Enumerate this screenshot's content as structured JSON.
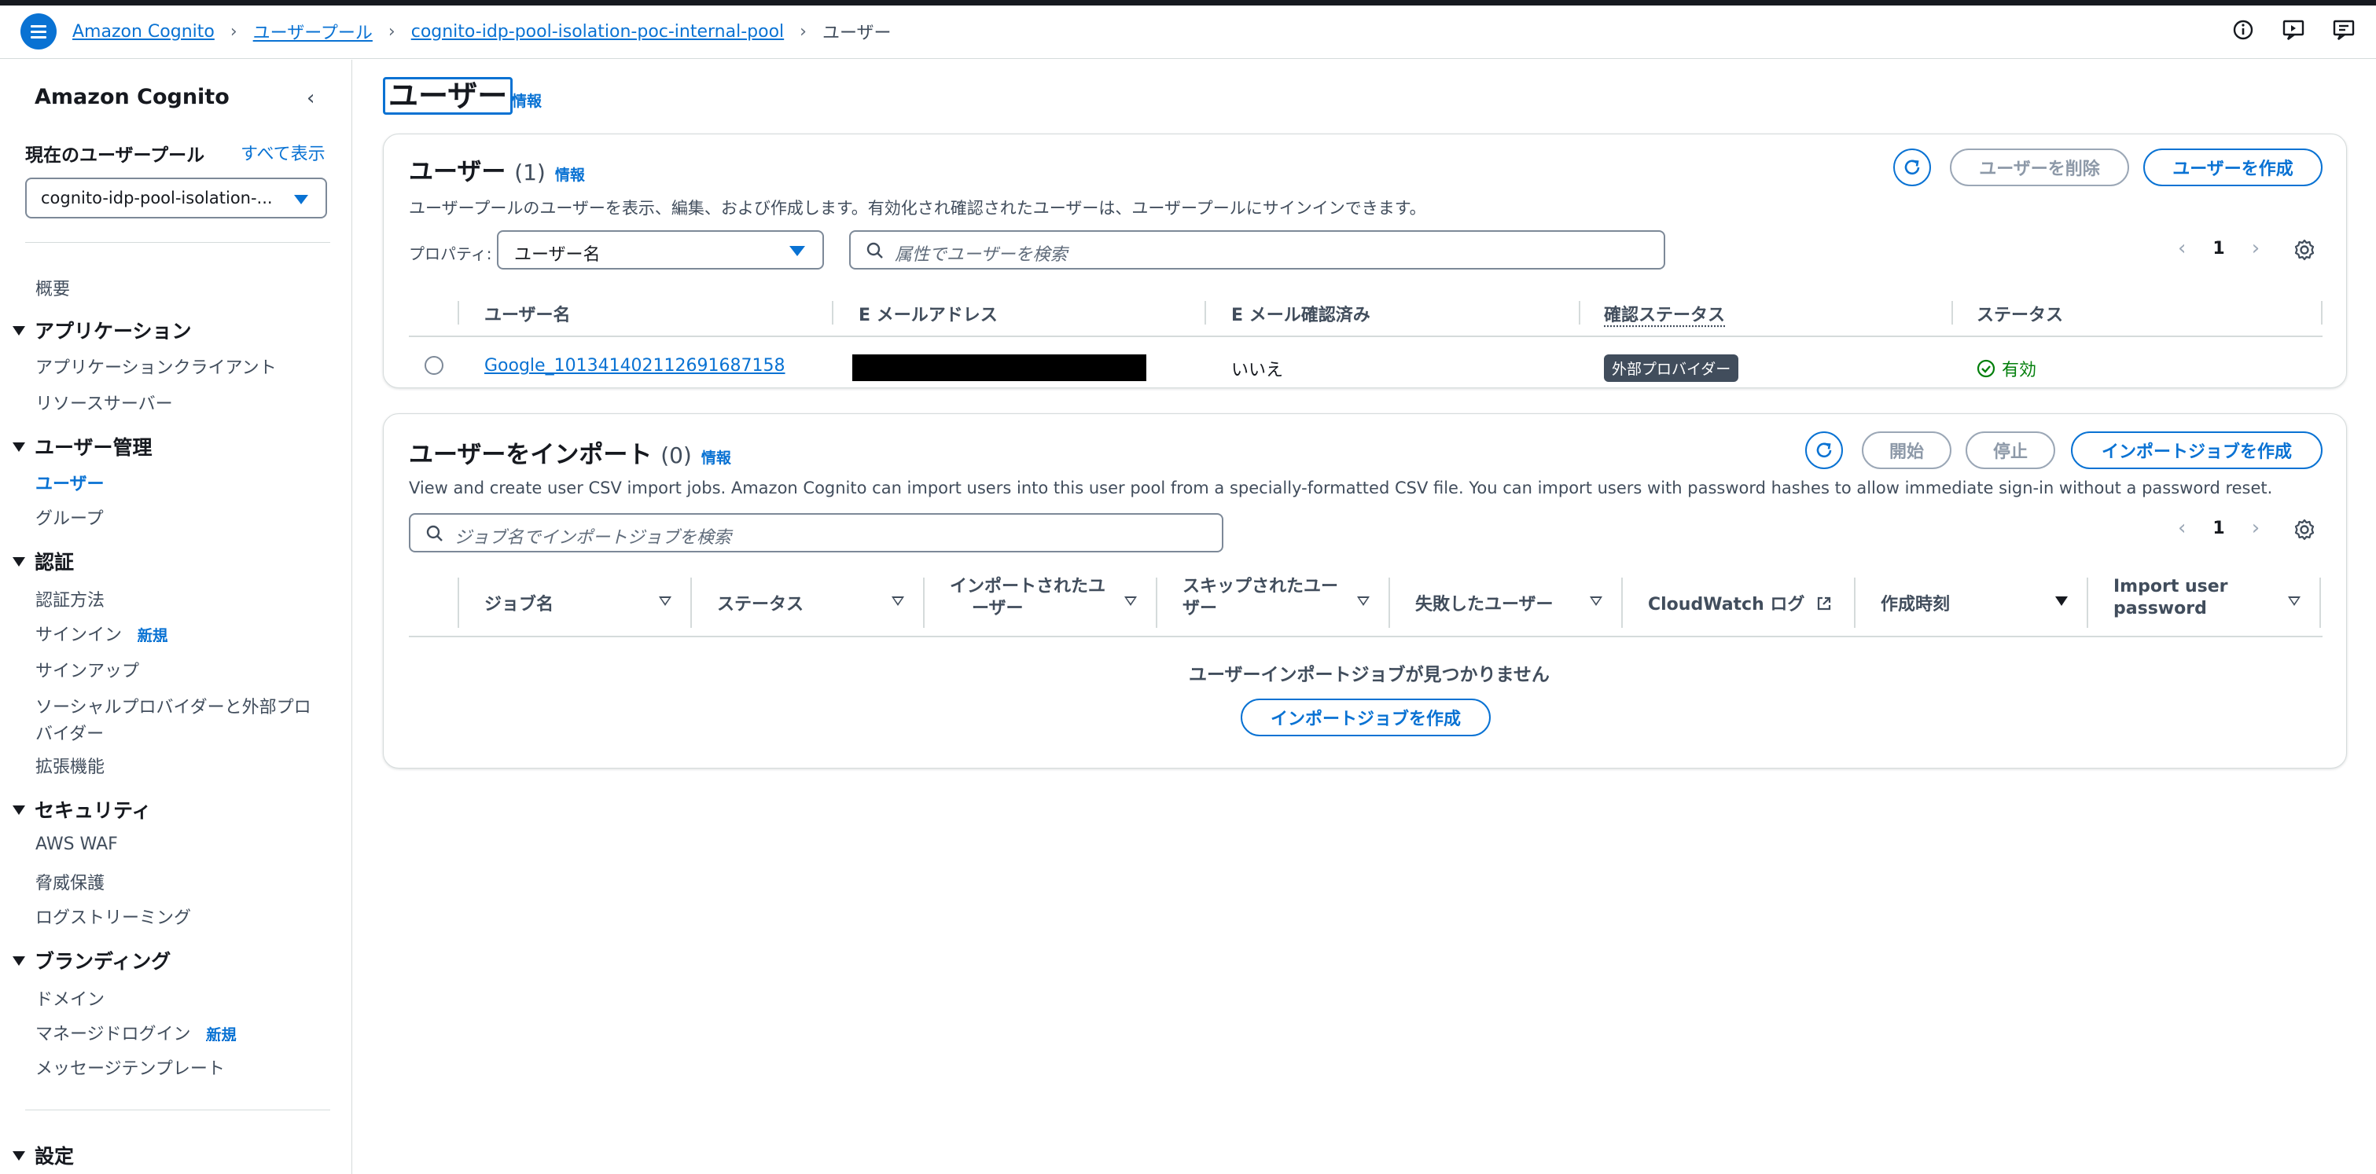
{
  "breadcrumbs": [
    {
      "label": "Amazon Cognito"
    },
    {
      "label": "ユーザープール"
    },
    {
      "label": "cognito-idp-pool-isolation-poc-internal-pool"
    },
    {
      "label": "ユーザー"
    }
  ],
  "sidebar": {
    "title": "Amazon Cognito",
    "pool_label": "現在のユーザープール",
    "show_all": "すべて表示",
    "pool_value": "cognito-idp-pool-isolation-...",
    "overview": "概要",
    "sections": [
      {
        "title": "アプリケーション",
        "items": [
          "アプリケーションクライアント",
          "リソースサーバー"
        ]
      },
      {
        "title": "ユーザー管理",
        "items": [
          "ユーザー",
          "グループ"
        ]
      },
      {
        "title": "認証",
        "items": [
          "認証方法",
          "サインイン",
          "サインアップ",
          "ソーシャルプロバイダーと外部プロ",
          "バイダー",
          "拡張機能"
        ]
      },
      {
        "title": "セキュリティ",
        "items": [
          "AWS WAF",
          "脅威保護",
          "ログストリーミング"
        ]
      },
      {
        "title": "ブランディング",
        "items": [
          "ドメイン",
          "マネージドログイン",
          "メッセージテンプレート"
        ]
      },
      {
        "title": "設定",
        "items": []
      }
    ],
    "new_badge": "新規"
  },
  "page": {
    "title": "ユーザー",
    "info": "情報"
  },
  "users_card": {
    "title": "ユーザー",
    "count": "(1)",
    "info": "情報",
    "description": "ユーザープールのユーザーを表示、編集、および作成します。有効化され確認されたユーザーは、ユーザープールにサインインできます。",
    "delete_button": "ユーザーを削除",
    "create_button": "ユーザーを作成",
    "property_label": "プロパティ:",
    "property_value": "ユーザー名",
    "search_placeholder": "属性でユーザーを検索",
    "page": "1",
    "columns": [
      "ユーザー名",
      "E メールアドレス",
      "E メール確認済み",
      "確認ステータス",
      "ステータス"
    ],
    "rows": [
      {
        "username": "Google_101341402112691687158",
        "email_verified": "いいえ",
        "confirmation": "外部プロバイダー",
        "status": "有効"
      }
    ]
  },
  "import_card": {
    "title": "ユーザーをインポート",
    "count": "(0)",
    "info": "情報",
    "description": "View and create user CSV import jobs. Amazon Cognito can import users into this user pool from a specially-formatted CSV file. You can import users with password hashes to allow immediate sign-in without a password reset.",
    "start_button": "開始",
    "stop_button": "停止",
    "create_button": "インポートジョブを作成",
    "search_placeholder": "ジョブ名でインポートジョブを検索",
    "page": "1",
    "columns": [
      "ジョブ名",
      "ステータス",
      "インポートされたユ",
      "ーザー",
      "スキップされたユー",
      "ザー",
      "失敗したユーザー",
      "CloudWatch ログ",
      "作成時刻",
      "Import user",
      "password"
    ],
    "empty_message": "ユーザーインポートジョブが見つかりません",
    "empty_create_button": "インポートジョブを作成"
  }
}
